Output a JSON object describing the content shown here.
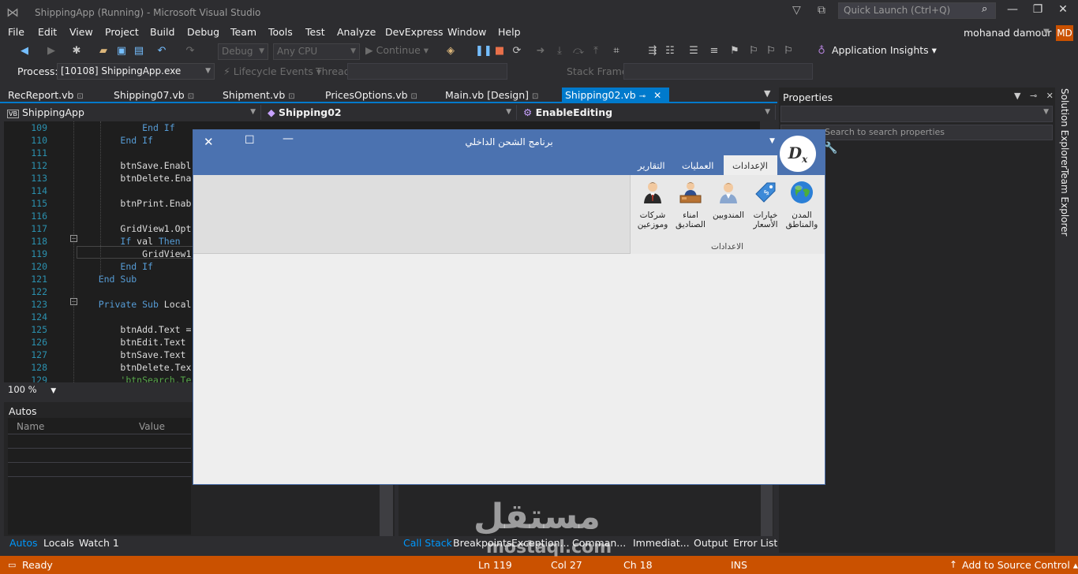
{
  "titlebar": {
    "title": "ShippingApp (Running) - Microsoft Visual Studio",
    "quick_launch_placeholder": "Quick Launch (Ctrl+Q)",
    "minimize": "—",
    "maximize": "❐",
    "close": "✕"
  },
  "menu": [
    "File",
    "Edit",
    "View",
    "Project",
    "Build",
    "Debug",
    "Team",
    "Tools",
    "Test",
    "Analyze",
    "DevExpress",
    "Window",
    "Help"
  ],
  "user": {
    "name": "mohanad damour",
    "initials": "MD"
  },
  "toolbar": {
    "config": "Debug",
    "platform": "Any CPU",
    "continue": "Continue",
    "app_insights": "Application Insights"
  },
  "debug_location": {
    "process_label": "Process:",
    "process_value": "[10108] ShippingApp.exe",
    "lifecycle": "Lifecycle Events",
    "thread_label": "Thread:",
    "stack_frame_label": "Stack Frame:"
  },
  "doc_tabs": [
    "RecReport.vb",
    "Shipping07.vb",
    "Shipment.vb",
    "PricesOptions.vb",
    "Main.vb [Design]",
    "Shipping02.vb"
  ],
  "navbar": {
    "project": "ShippingApp",
    "class": "Shipping02",
    "member": "EnableEditing",
    "vb_badge": "VB"
  },
  "code_lines": [
    {
      "n": "109",
      "i": "            ",
      "k": "End If",
      "t": ""
    },
    {
      "n": "110",
      "i": "        ",
      "k": "End If",
      "t": ""
    },
    {
      "n": "111",
      "i": "",
      "k": "",
      "t": ""
    },
    {
      "n": "112",
      "i": "        ",
      "k": "",
      "t": "btnSave.Enabl"
    },
    {
      "n": "113",
      "i": "        ",
      "k": "",
      "t": "btnDelete.Ena"
    },
    {
      "n": "114",
      "i": "",
      "k": "",
      "t": ""
    },
    {
      "n": "115",
      "i": "        ",
      "k": "",
      "t": "btnPrint.Enab"
    },
    {
      "n": "116",
      "i": "",
      "k": "",
      "t": ""
    },
    {
      "n": "117",
      "i": "        ",
      "k": "",
      "t": "GridView1.Opt"
    },
    {
      "n": "118",
      "i": "        ",
      "k": "If",
      "t": " val ",
      "k2": "Then"
    },
    {
      "n": "119",
      "i": "            ",
      "k": "",
      "t": "GridView1"
    },
    {
      "n": "120",
      "i": "        ",
      "k": "End If",
      "t": ""
    },
    {
      "n": "121",
      "i": "    ",
      "k": "End Sub",
      "t": ""
    },
    {
      "n": "122",
      "i": "",
      "k": "",
      "t": ""
    },
    {
      "n": "123",
      "i": "    ",
      "k": "Private Sub",
      "t": " Local"
    },
    {
      "n": "124",
      "i": "",
      "k": "",
      "t": ""
    },
    {
      "n": "125",
      "i": "        ",
      "k": "",
      "t": "btnAdd.Text ="
    },
    {
      "n": "126",
      "i": "        ",
      "k": "",
      "t": "btnEdit.Text"
    },
    {
      "n": "127",
      "i": "        ",
      "k": "",
      "t": "btnSave.Text"
    },
    {
      "n": "128",
      "i": "        ",
      "k": "",
      "t": "btnDelete.Tex"
    },
    {
      "n": "129",
      "i": "        ",
      "k": "",
      "t": "",
      "c": "'btnSearch.Te"
    }
  ],
  "zoom": "100 %",
  "autos": {
    "title": "Autos",
    "col_name": "Name",
    "col_value": "Value"
  },
  "bottom_tabs_left": [
    "Autos",
    "Locals",
    "Watch 1"
  ],
  "bottom_tabs_right": [
    "Call Stack",
    "Breakpoints",
    "Exception...",
    "Comman...",
    "Immediat...",
    "Output",
    "Error List"
  ],
  "properties": {
    "title": "Properties",
    "search_placeholder": "Search to search properties"
  },
  "side_tabs": [
    "Solution Explorer",
    "Team Explorer"
  ],
  "status": {
    "ready": "Ready",
    "ln": "Ln 119",
    "col": "Col 27",
    "ch": "Ch 18",
    "ins": "INS",
    "source_control": "Add to Source Control"
  },
  "watermark": {
    "arabic": "مستقل",
    "latin": "mostaql.com"
  },
  "form": {
    "title": "برنامج الشحن الداخلي",
    "logo": "D",
    "logo_sub": "x",
    "tabs": {
      "settings": "الإعدادات",
      "operations": "العمليات",
      "reports": "التقارير"
    },
    "group_caption": "الاعدادات",
    "buttons": [
      {
        "label": "المدن\nوالمناطق",
        "icon": "globe-icon"
      },
      {
        "label": "خيارات\nالأسعار",
        "icon": "price-tag-icon"
      },
      {
        "label": "المندوبين",
        "icon": "people-icon"
      },
      {
        "label": "امناء\nالصناديق",
        "icon": "cashier-icon"
      },
      {
        "label": "شركات\nوموزعين",
        "icon": "businessman-icon"
      }
    ]
  },
  "colors": {
    "accent": "#007acc",
    "status_bar": "#ca5100",
    "form_header": "#4b72b0"
  }
}
